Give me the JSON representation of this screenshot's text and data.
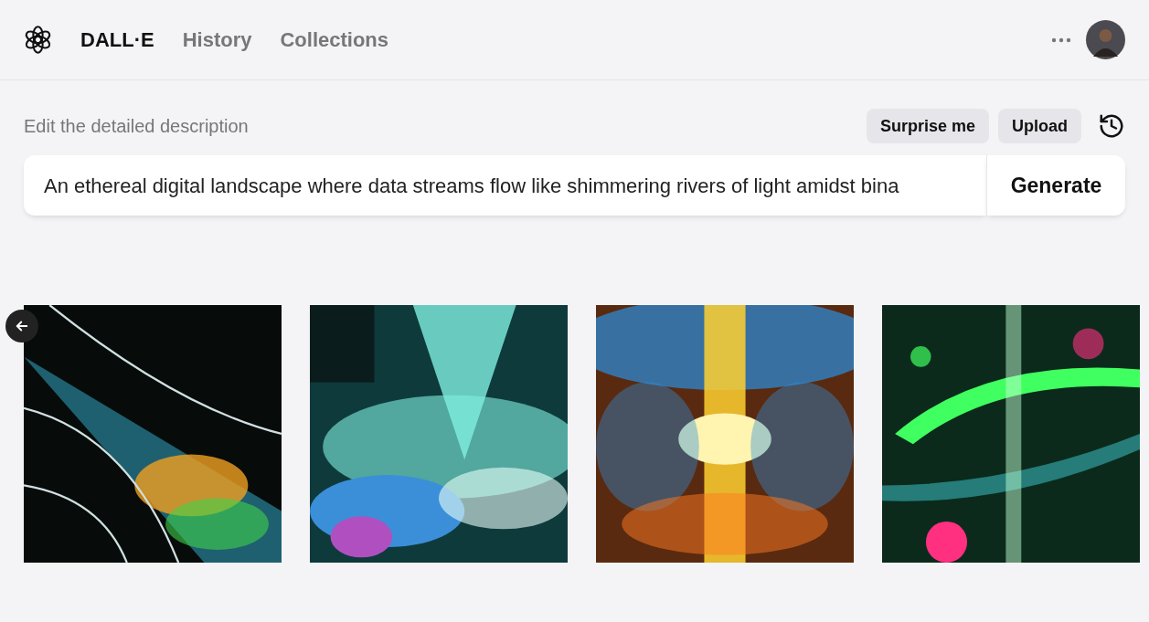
{
  "nav": [
    {
      "label": "DALL·E",
      "selected": true
    },
    {
      "label": "History",
      "selected": false
    },
    {
      "label": "Collections",
      "selected": false
    }
  ],
  "prompt": {
    "label": "Edit the detailed description",
    "value": "An ethereal digital landscape where data streams flow like shimmering rivers of light amidst bina"
  },
  "buttons": [
    "Surprise me",
    "Upload"
  ],
  "generate": "Generate",
  "images": [
    {
      "kind": "picture"
    },
    {
      "kind": "picture"
    },
    {
      "kind": "picture"
    },
    {
      "kind": "picture"
    }
  ]
}
